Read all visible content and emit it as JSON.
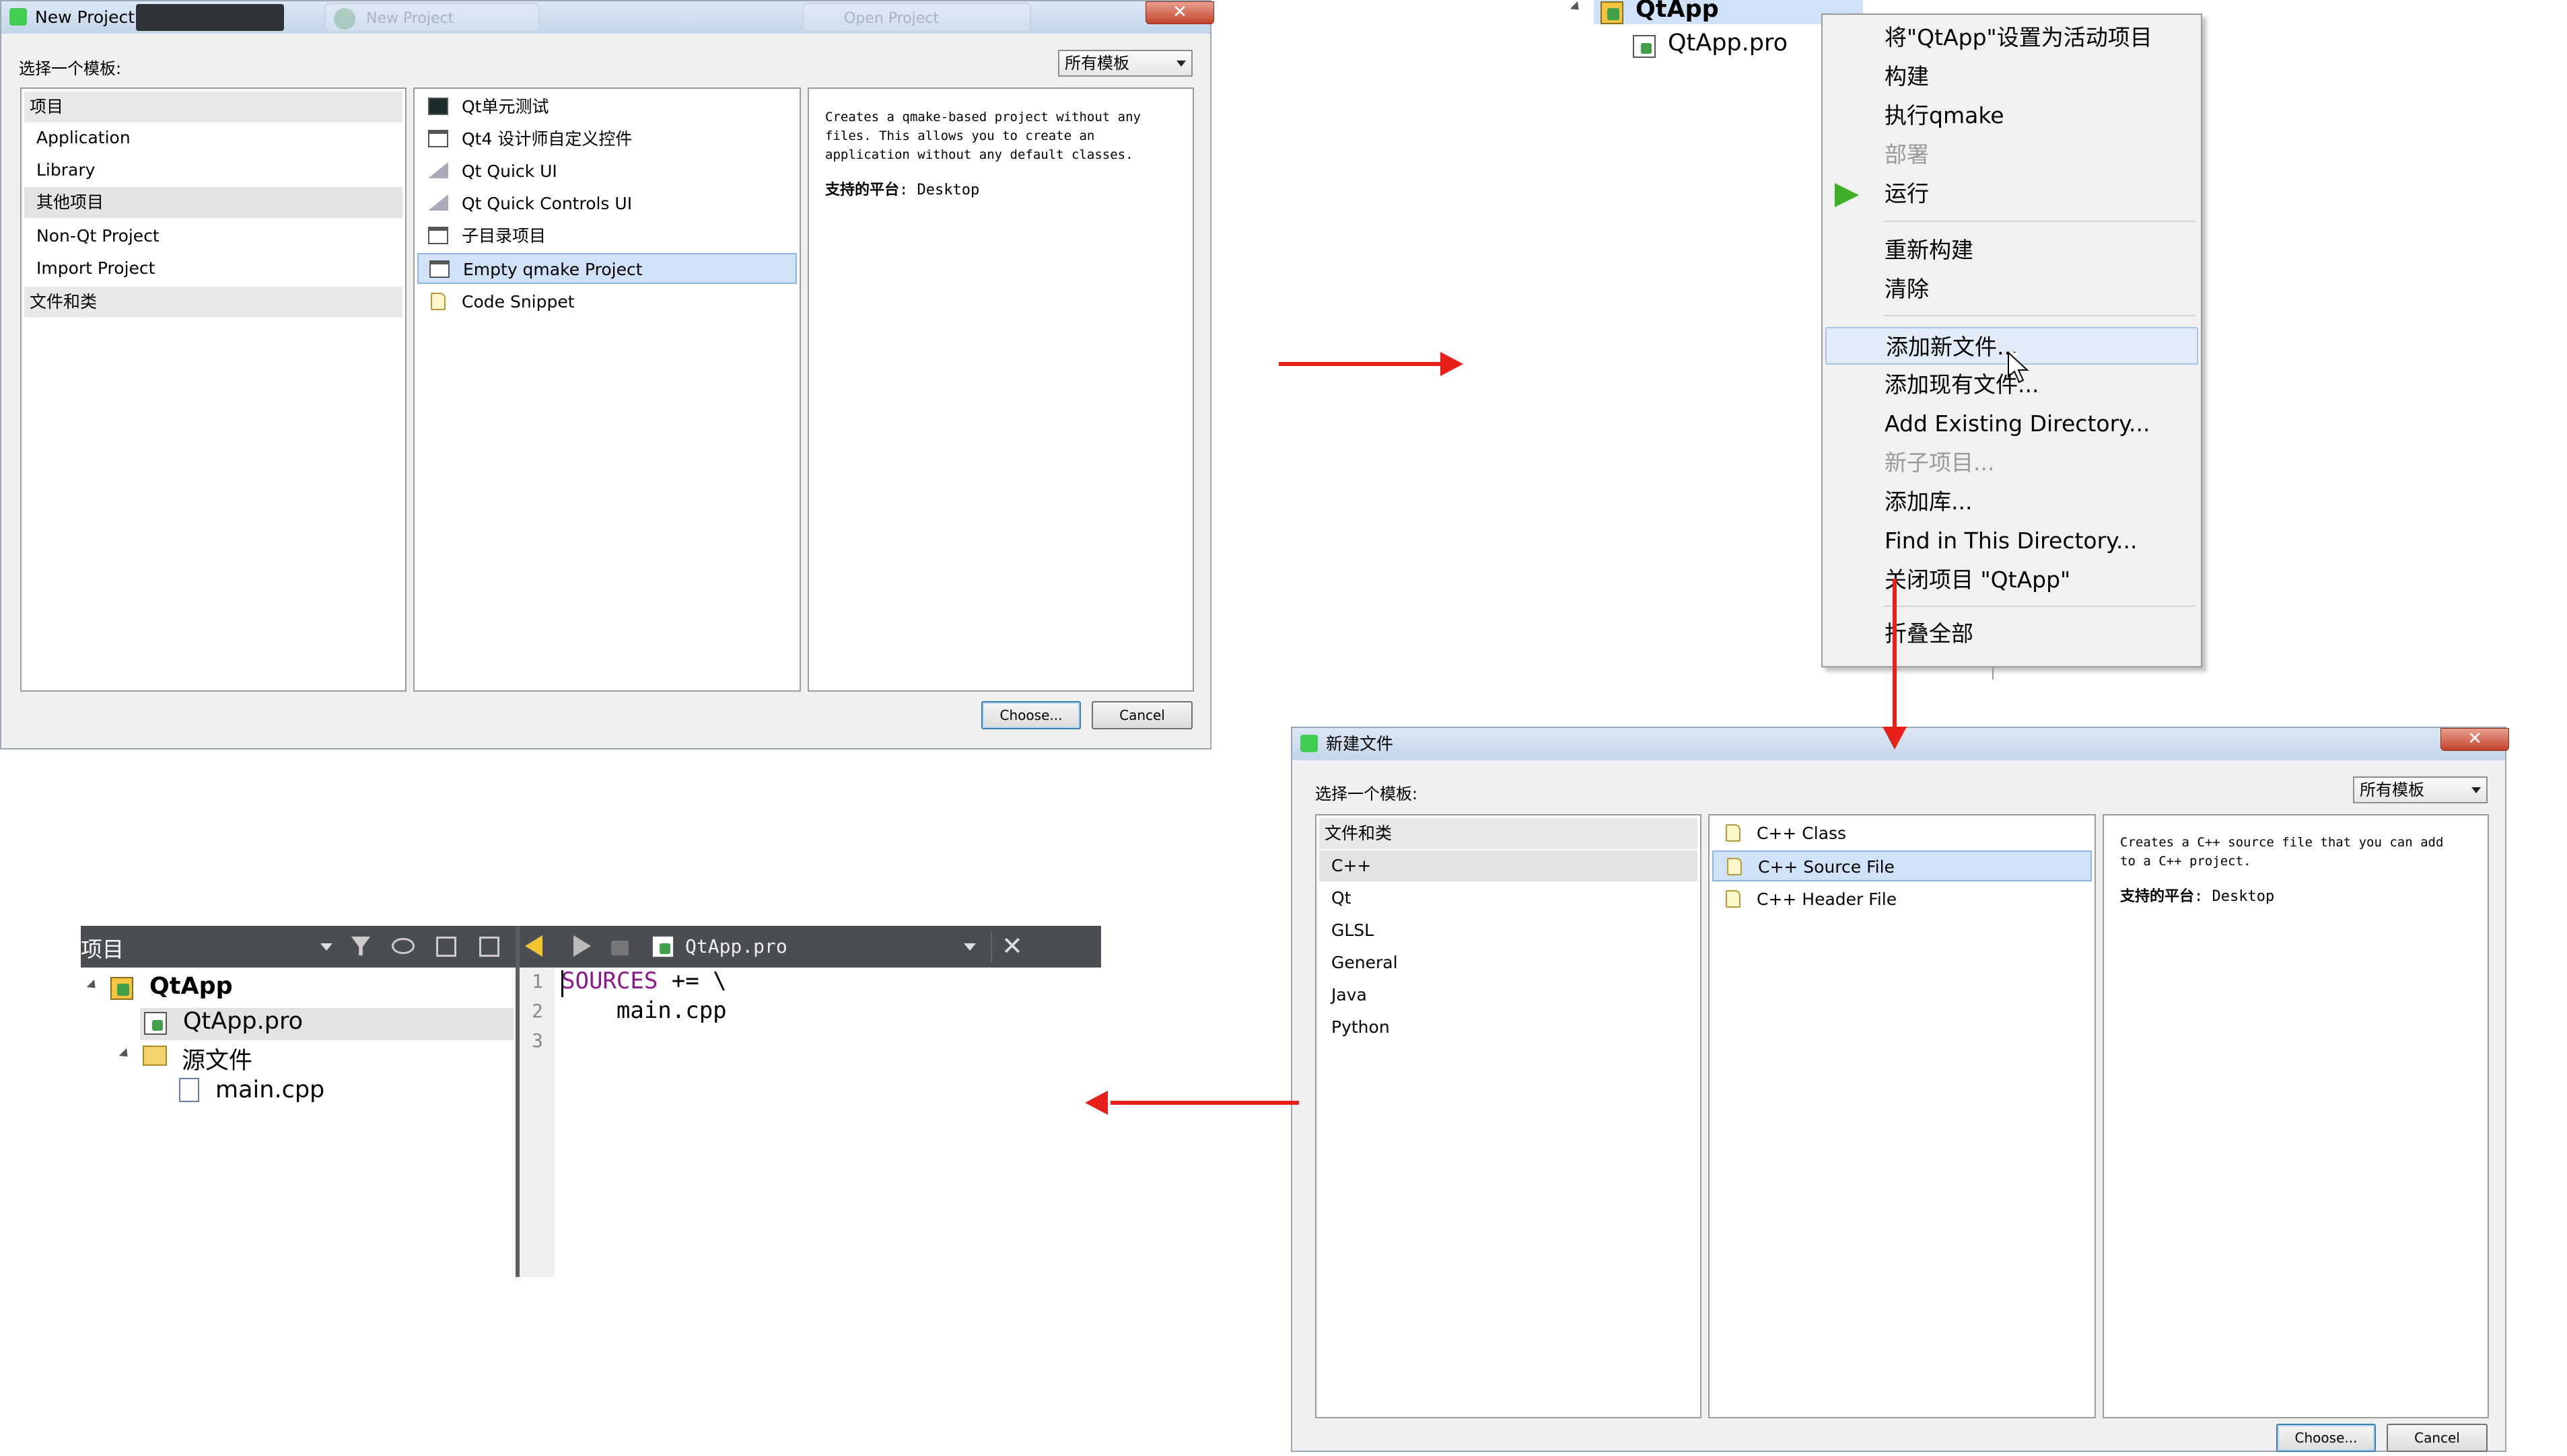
{
  "new_project": {
    "title": "New Project",
    "ghost_tabs": [
      "New Project",
      "Open Project"
    ],
    "choose_label": "选择一个模板:",
    "filter": "所有模板",
    "categories": [
      "项目",
      "Application",
      "Library",
      "其他项目",
      "Non-Qt Project",
      "Import Project",
      "文件和类"
    ],
    "templates": [
      "Qt单元测试",
      "Qt4 设计师自定义控件",
      "Qt Quick UI",
      "Qt Quick Controls UI",
      "子目录项目",
      "Empty qmake Project",
      "Code Snippet"
    ],
    "description": [
      "Creates a qmake-based project without any",
      "files. This allows you to create an",
      "application without any default classes."
    ],
    "platform_label": "支持的平台",
    "platform_value": ": Desktop",
    "choose_button": "Choose...",
    "cancel_button": "Cancel"
  },
  "context_menu": {
    "tree_root": "QtApp",
    "tree_file": "QtApp.pro",
    "items": [
      "将\"QtApp\"设置为活动项目",
      "构建",
      "执行qmake",
      "部署",
      "运行",
      "重新构建",
      "清除",
      "添加新文件...",
      "添加现有文件...",
      "Add Existing Directory...",
      "新子项目...",
      "添加库...",
      "Find in This Directory...",
      "关闭项目 \"QtApp\"",
      "折叠全部"
    ]
  },
  "new_file": {
    "title": "新建文件",
    "choose_label": "选择一个模板:",
    "filter": "所有模板",
    "categories": [
      "文件和类",
      "C++",
      "Qt",
      "GLSL",
      "General",
      "Java",
      "Python"
    ],
    "templates": [
      "C++ Class",
      "C++ Source File",
      "C++ Header File"
    ],
    "description": [
      "Creates a C++ source file that you can add",
      "to a C++ project."
    ],
    "platform_label": "支持的平台",
    "platform_value": ": Desktop",
    "choose_button": "Choose...",
    "cancel_button": "Cancel"
  },
  "result": {
    "panel_title": "项目",
    "editor_file": "QtApp.pro",
    "tree": [
      "QtApp",
      "QtApp.pro",
      "源文件",
      "main.cpp"
    ],
    "line_numbers": [
      "1",
      "2",
      "3"
    ],
    "code_line1_keyword": "SOURCES",
    "code_line1_rest": " += \\",
    "code_line2": "    main.cpp"
  },
  "colors": {
    "arrow": "#e8201a",
    "qt_green": "#41cd52",
    "selection": "#cfe2f7",
    "keyword": "#8b1a8b"
  }
}
